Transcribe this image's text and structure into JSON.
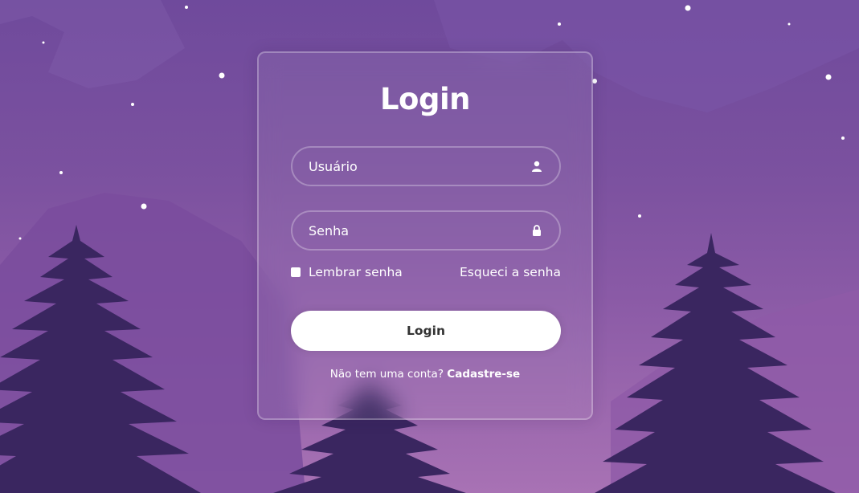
{
  "theme": {
    "background_top": "#6f4a9c",
    "background_bottom": "#a872b4",
    "mountain_color": "#7a4c9d",
    "tree_color": "#3a2660",
    "button_bg": "#ffffff",
    "button_text": "#333333"
  },
  "login_card": {
    "title": "Login",
    "username": {
      "placeholder": "Usuário",
      "value": "",
      "icon": "user-icon"
    },
    "password": {
      "placeholder": "Senha",
      "value": "",
      "icon": "lock-icon"
    },
    "remember_label": "Lembrar senha",
    "remember_checked": false,
    "forgot_label": "Esqueci a senha",
    "submit_label": "Login",
    "register_prompt": "Não tem uma conta?",
    "register_link": "Cadastre-se"
  }
}
